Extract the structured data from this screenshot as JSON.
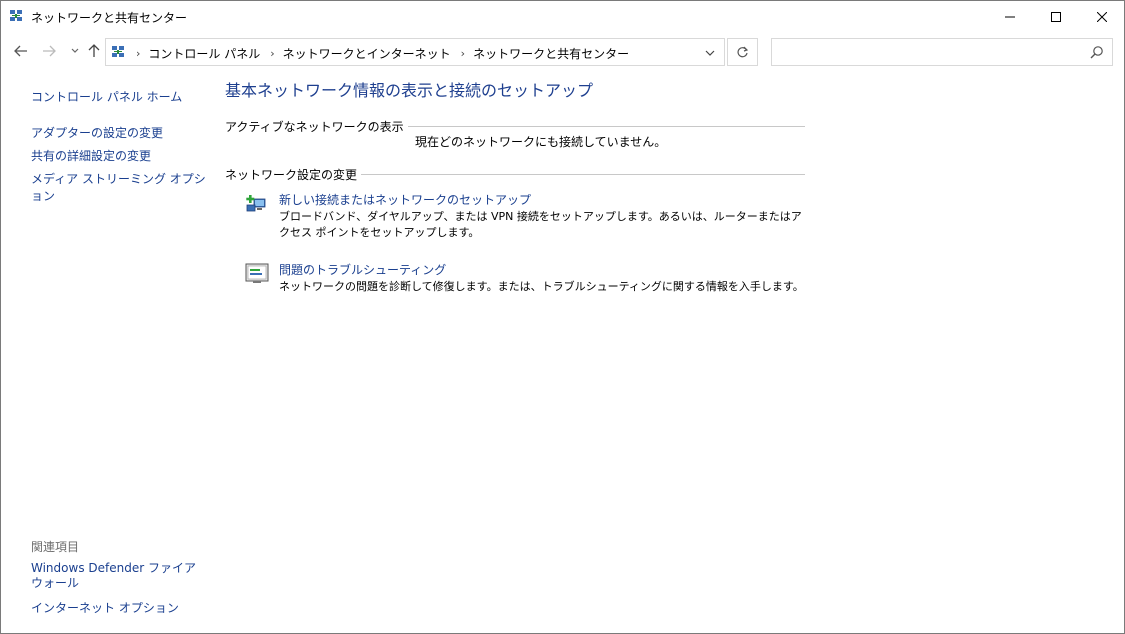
{
  "window": {
    "title": "ネットワークと共有センター"
  },
  "address": {
    "crumbs": [
      "コントロール パネル",
      "ネットワークとインターネット",
      "ネットワークと共有センター"
    ],
    "search_placeholder": ""
  },
  "left": {
    "home": "コントロール パネル ホーム",
    "links": [
      "アダプターの設定の変更",
      "共有の詳細設定の変更",
      "メディア ストリーミング オプション"
    ],
    "related_heading": "関連項目",
    "defender": "Windows Defender ファイアウォール",
    "internet_options": "インターネット オプション"
  },
  "main": {
    "heading": "基本ネットワーク情報の表示と接続のセットアップ",
    "active_section": "アクティブなネットワークの表示",
    "no_connection": "現在どのネットワークにも接続していません。",
    "change_section": "ネットワーク設定の変更",
    "tasks": [
      {
        "title": "新しい接続またはネットワークのセットアップ",
        "desc": "ブロードバンド、ダイヤルアップ、または VPN 接続をセットアップします。あるいは、ルーターまたはアクセス ポイントをセットアップします。",
        "icon": "new-connection-icon"
      },
      {
        "title": "問題のトラブルシューティング",
        "desc": "ネットワークの問題を診断して修復します。または、トラブルシューティングに関する情報を入手します。",
        "icon": "troubleshoot-icon"
      }
    ]
  },
  "colors": {
    "link": "#1a3f8f",
    "heading": "#1e3f8f",
    "muted": "#6d6d6d"
  }
}
